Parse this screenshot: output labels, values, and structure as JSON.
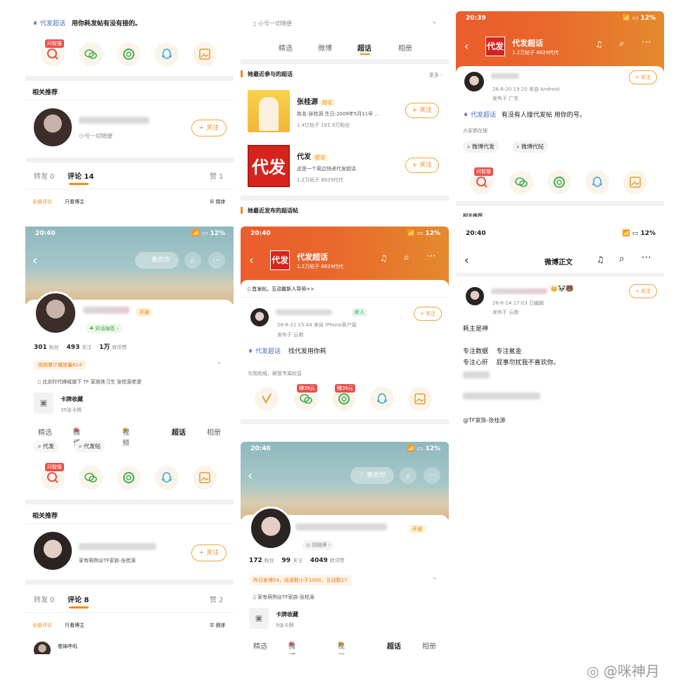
{
  "watermark": "@咪神月",
  "p1": {
    "supertopic": "代发超话",
    "post_text": "用你耗发帖有没有接的。",
    "share_tag": "问智搜",
    "section_title": "相关推荐",
    "rec_sub": "小号一切随便",
    "follow": "+ 关注",
    "tab_forward": "转发 0",
    "tab_comment": "评论 14",
    "tab_like": "赞 1",
    "filter_all": "全部评论",
    "filter_author": "只看博主",
    "sort": "倒序"
  },
  "p2": {
    "sub_header": "小号一切随便",
    "tabs": [
      "精选",
      "微博",
      "超话",
      "相册"
    ],
    "active_tab": "超话",
    "section1": "她最近参与的超话",
    "more": "更多",
    "items": [
      {
        "name": "张桂源",
        "tag": "超话",
        "desc": "姓名:张桂源 生日:2009年5月11号 ...",
        "stats": "1.4亿帖子  181.9万粉丝",
        "follow": "+ 关注"
      },
      {
        "name": "代发",
        "tag": "超话",
        "desc": "这是一个周边快递代发超话",
        "stats": "1.2万帖子  8829代代",
        "follow": "+ 关注"
      }
    ],
    "badge_text": "代发",
    "section2": "她最近发布的超话帖"
  },
  "p3": {
    "time": "20:39",
    "battery": "12%",
    "title": "代发超话",
    "subtitle": "1.2万帖子  8829代代",
    "badge_text": "代发",
    "follow": "+ 关注",
    "meta": "26-8-20  19:20  来自 Android",
    "location": "发布于 广东",
    "topic": "代发超话",
    "post": "有没有人接代发帖  用你的号。",
    "searching": "大家都在搜",
    "chip1": "微博代发",
    "chip2": "微博代帖",
    "share_tag": "问智搜",
    "bottom_cut": "相关推荐"
  },
  "p4": {
    "time": "20:40",
    "battery": "12%",
    "like_btn": "喜欢你",
    "vip": "开通",
    "checkin": "好运抽签",
    "followers_n": "301",
    "followers_l": "粉丝",
    "following_n": "493",
    "following_l": "关注",
    "likes_n": "1万",
    "likes_l": "转评赞",
    "honor": "视频累计播放量614",
    "bio": "北京时代峰峻旗下 TF 家族练习生  张桂源老婆",
    "card_title": "卡牌收藏",
    "card_sub": "35张卡牌",
    "tabs": [
      "精选",
      "微博",
      "视频",
      "超话",
      "相册"
    ],
    "active_tab": "超话",
    "chip1": "代发",
    "chip2": "代发帖",
    "share_tag": "问智搜",
    "section_title": "相关推荐",
    "rec_sub": "家有萌狗@TF家族-张桂源",
    "follow": "+ 关注",
    "tab_forward": "转发 0",
    "tab_comment": "评论 8",
    "tab_like": "赞 2",
    "filter_all": "全部评论",
    "filter_author": "只看博主",
    "sort": "倒序",
    "commenter": "卷妹呼叽"
  },
  "p5": {
    "time": "20:40",
    "battery": "12%",
    "title": "代发超话",
    "subtitle": "1.2万帖子  8829代代",
    "badge_text": "代发",
    "notice": "首发帖，互动赢新人导师>>",
    "meta": "26-8-21  15:44  来自 iPhone客户端",
    "location": "发布于 云南",
    "newbie": "新人",
    "follow": "+ 关注",
    "topic": "代发超话",
    "post": "找代发用你耗",
    "help": "为我助威，解锁专属权益",
    "tag1": "赚38元",
    "tag2": "赚38元"
  },
  "p6": {
    "time": "20:40",
    "battery": "12%",
    "like_btn": "喜欢你",
    "vip": "开通",
    "sub_badge": "到微博",
    "followers_n": "172",
    "followers_l": "粉丝",
    "following_n": "99",
    "following_l": "关注",
    "likes_n": "4049",
    "likes_l": "转评赞",
    "honor": "昨日发博54，阅读数小于1000，互动数27",
    "bio": "家有萌狗@TF家族-张桂源",
    "card_title": "卡牌收藏",
    "card_sub": "9张卡牌",
    "tabs": [
      "精选",
      "微博",
      "视频",
      "超话",
      "相册"
    ],
    "active_tab": "超话"
  },
  "p7": {
    "time": "20:40",
    "battery": "12%",
    "title": "微博正文",
    "follow": "+ 关注",
    "meta": "26-8-14  17:03  已编辑",
    "location": "发布于 云南",
    "line1": "耗主是神",
    "line2": "专注数据    专注氪金",
    "line3": "专注心肝    屁事勿扰我不喜欢你。",
    "mention": "@TF家族-张桂源"
  },
  "colors": {
    "orange": "#f08c1a",
    "brand_red": "#e5504a",
    "topbar": "#e9642c"
  }
}
